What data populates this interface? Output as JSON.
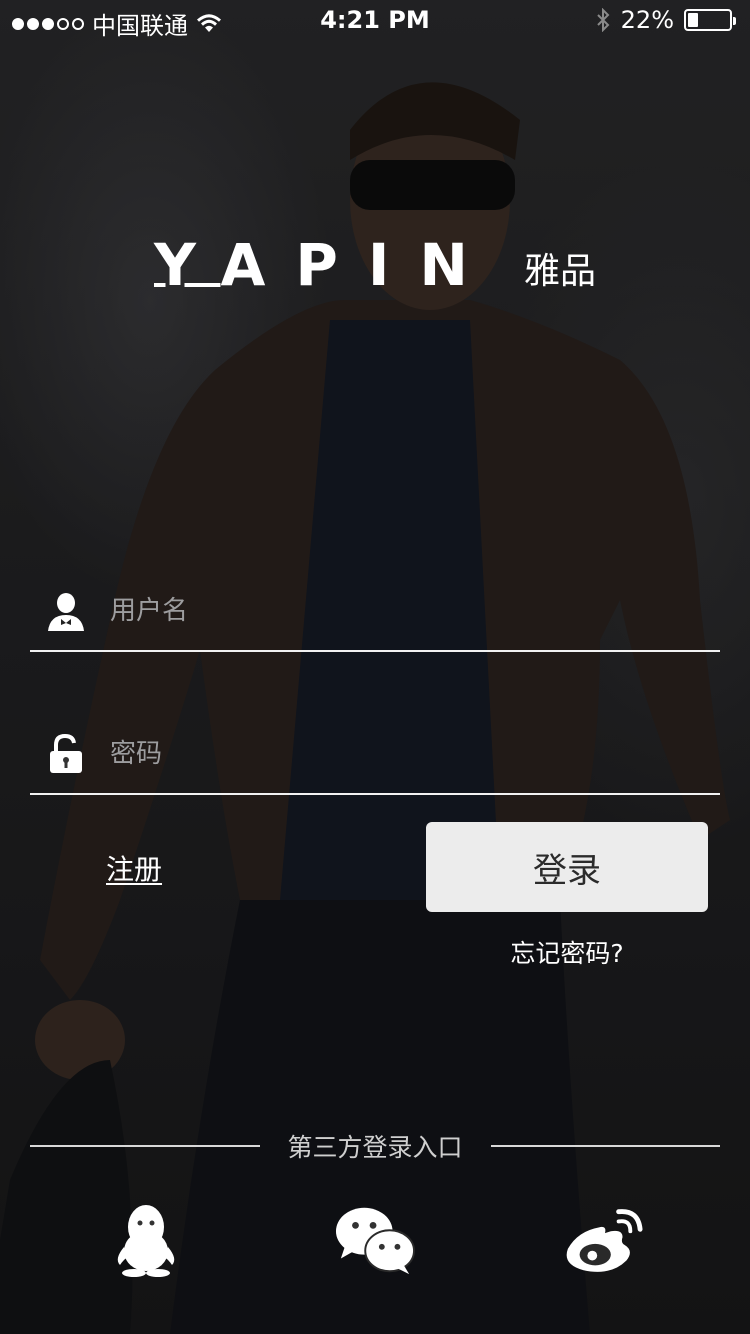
{
  "status_bar": {
    "carrier": "中国联通",
    "time": "4:21 PM",
    "battery": "22%",
    "battery_level": 0.22,
    "signal_strength": 3,
    "icons": [
      "signal-dots-icon",
      "wifi-icon",
      "bluetooth-icon",
      "battery-icon"
    ]
  },
  "logo": {
    "first_letter": "Y",
    "rest_letters": "APIN",
    "chinese": "雅品"
  },
  "login_form": {
    "username_placeholder": "用户名",
    "username_value": "",
    "password_placeholder": "密码",
    "password_value": "",
    "username_icon": "user-icon",
    "password_icon": "lock-icon"
  },
  "actions": {
    "register_label": "注册",
    "login_label": "登录",
    "forgot_label": "忘记密码?"
  },
  "third_party": {
    "label": "第三方登录入口",
    "providers": [
      "qq-icon",
      "wechat-icon",
      "weibo-icon"
    ]
  },
  "colors": {
    "button_bg": "#ececec",
    "button_text": "#2b2b2b",
    "placeholder": "#9d9d9f",
    "divider": "#f2f2f2"
  }
}
